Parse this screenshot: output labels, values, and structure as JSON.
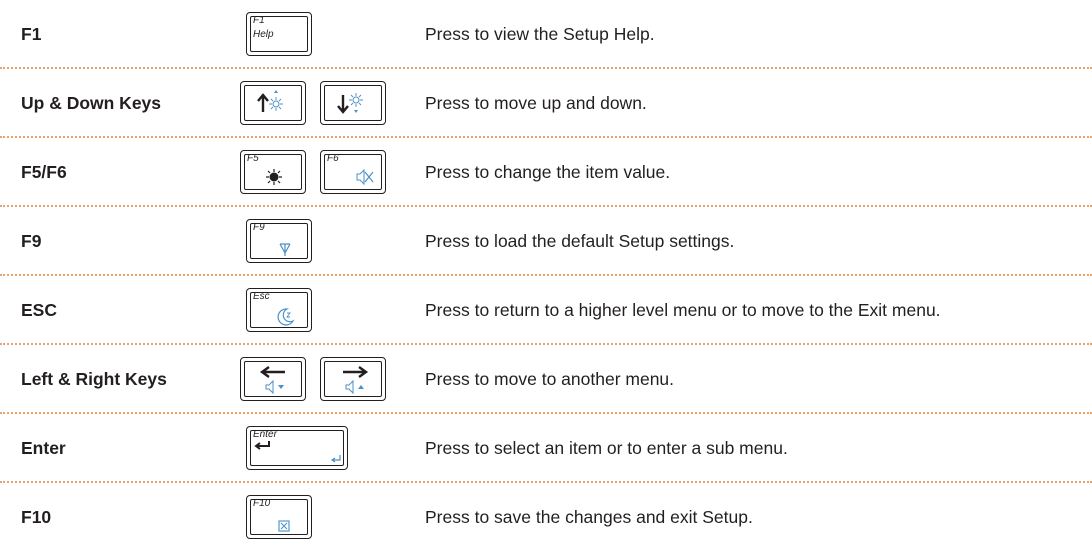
{
  "rows": [
    {
      "name": "F1",
      "desc": "Press to view the Setup Help.",
      "keys": [
        {
          "label": "F1",
          "sublabel": "Help",
          "icon": "help-text"
        }
      ]
    },
    {
      "name": "Up & Down Keys",
      "desc": "Press to move up and down.",
      "keys": [
        {
          "label": "",
          "icon": "up-arrow-brightness-up-icon"
        },
        {
          "label": "",
          "icon": "down-arrow-brightness-down-icon"
        }
      ]
    },
    {
      "name": "F5/F6",
      "desc": "Press to change the item value.",
      "keys": [
        {
          "label": "F5",
          "icon": "brightness-icon"
        },
        {
          "label": "F6",
          "icon": "mute-icon"
        }
      ]
    },
    {
      "name": "F9",
      "desc": "Press to load the default Setup settings.",
      "keys": [
        {
          "label": "F9",
          "icon": "wireless-antenna-icon"
        }
      ]
    },
    {
      "name": "ESC",
      "desc": "Press to return to a higher level menu or to move to the Exit menu.",
      "keys": [
        {
          "label": "Esc",
          "icon": "sleep-moon-icon"
        }
      ]
    },
    {
      "name": "Left & Right Keys",
      "desc": "Press to move to another menu.",
      "keys": [
        {
          "label": "",
          "icon": "left-arrow-volume-down-icon"
        },
        {
          "label": "",
          "icon": "right-arrow-volume-up-icon"
        }
      ]
    },
    {
      "name": "Enter",
      "desc": "Press to select an item or to enter a sub menu.",
      "keys": [
        {
          "label": "Enter",
          "icon": "enter-return-icon"
        }
      ]
    },
    {
      "name": "F10",
      "desc": "Press to save the changes and exit Setup.",
      "keys": [
        {
          "label": "F10",
          "icon": "display-switch-icon"
        }
      ]
    }
  ],
  "colors": {
    "separator": "#e7a471",
    "icon_accent": "#4a90c8",
    "text": "#231f20"
  }
}
